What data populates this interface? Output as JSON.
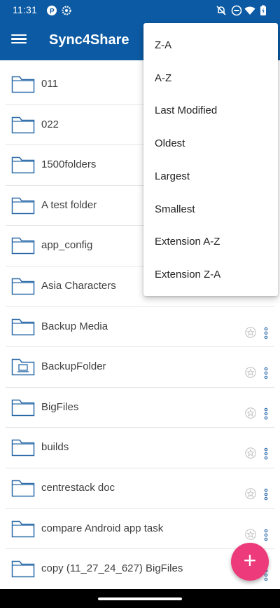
{
  "status_bar": {
    "time": "11:31",
    "icons": [
      "pinterest-like-icon",
      "settings-icon",
      "mute-icon",
      "dnd-icon",
      "wifi-icon",
      "battery-icon"
    ]
  },
  "app_bar": {
    "title": "Sync4Share",
    "menu_icon": "hamburger-icon"
  },
  "sort_menu": {
    "items": [
      "Z-A",
      "A-Z",
      "Last Modified",
      "Oldest",
      "Largest",
      "Smallest",
      "Extension A-Z",
      "Extension Z-A"
    ]
  },
  "folders": [
    {
      "name": "011",
      "icon": "folder-icon",
      "actions": false
    },
    {
      "name": "022",
      "icon": "folder-icon",
      "actions": false
    },
    {
      "name": "1500folders",
      "icon": "folder-icon",
      "actions": false
    },
    {
      "name": "A test folder",
      "icon": "folder-icon",
      "actions": false
    },
    {
      "name": "app_config",
      "icon": "folder-icon",
      "actions": false
    },
    {
      "name": "Asia Characters",
      "icon": "folder-icon",
      "actions": false
    },
    {
      "name": "Backup Media",
      "icon": "folder-icon",
      "actions": true
    },
    {
      "name": "BackupFolder",
      "icon": "backup-folder-icon",
      "actions": true
    },
    {
      "name": "BigFiles",
      "icon": "folder-icon",
      "actions": true
    },
    {
      "name": "builds",
      "icon": "folder-icon",
      "actions": true
    },
    {
      "name": "centrestack doc",
      "icon": "folder-icon",
      "actions": true
    },
    {
      "name": "compare Android app task",
      "icon": "folder-icon",
      "actions": true
    },
    {
      "name": "copy (11_27_24_627) BigFiles",
      "icon": "folder-icon",
      "actions": true
    }
  ],
  "fab": {
    "label": "+",
    "icon": "plus-icon"
  },
  "colors": {
    "primary": "#0b5aa3",
    "accent": "#ec3a7a",
    "folder_stroke": "#2b6aa8"
  }
}
